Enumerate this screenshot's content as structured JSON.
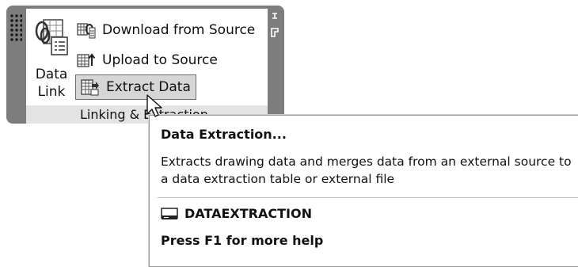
{
  "panel": {
    "title": "Linking & Extraction",
    "data_link": {
      "label": "Data\nLink",
      "icon": "data-link-icon"
    },
    "commands": [
      {
        "label": "Download from Source",
        "icon": "download-from-source-icon"
      },
      {
        "label": "Upload to Source",
        "icon": "upload-to-source-icon"
      },
      {
        "label": "Extract  Data",
        "icon": "extract-data-icon",
        "highlighted": true
      }
    ]
  },
  "tooltip": {
    "title": "Data Extraction...",
    "description_line1": "Extracts drawing data and merges data from an external source to",
    "description_line2": "a data extraction table or external file",
    "command": "DATAEXTRACTION",
    "help": "Press F1 for more help"
  },
  "colors": {
    "panel_border": "#7d7d7d",
    "panel_title_bg": "#e3e3e3",
    "highlight_bg": "#d6d6d6"
  }
}
